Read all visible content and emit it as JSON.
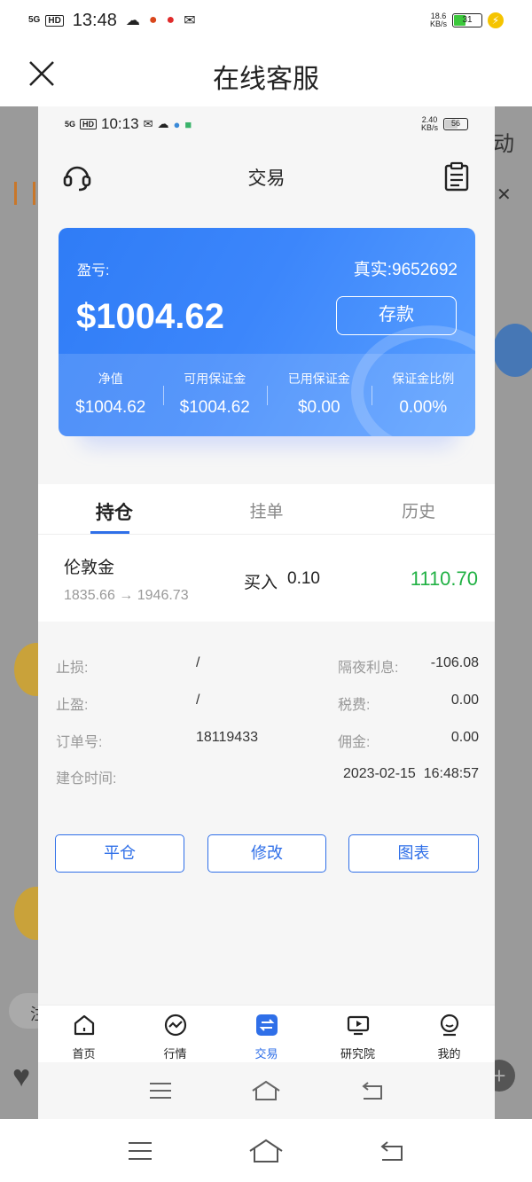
{
  "outer_status": {
    "network": "5G",
    "hd": "HD",
    "time": "13:48",
    "speed_value": "18.6",
    "speed_unit": "KB/s",
    "battery": "31"
  },
  "outer_header": {
    "title": "在线客服"
  },
  "backdrop": {
    "partial_text_right": "动",
    "partial_text_left": "注"
  },
  "inner_status": {
    "network": "5G",
    "hd": "HD",
    "time": "10:13",
    "speed_value": "2.40",
    "speed_unit": "KB/s",
    "battery": "56"
  },
  "header": {
    "title": "交易"
  },
  "account_card": {
    "pl_label": "盈亏:",
    "account": "真实:9652692",
    "amount": "$1004.62",
    "deposit_label": "存款",
    "stats": [
      {
        "label": "净值",
        "value": "$1004.62"
      },
      {
        "label": "可用保证金",
        "value": "$1004.62"
      },
      {
        "label": "已用保证金",
        "value": "$0.00"
      },
      {
        "label": "保证金比例",
        "value": "0.00%"
      }
    ]
  },
  "tabs": [
    {
      "label": "持仓",
      "active": true
    },
    {
      "label": "挂单",
      "active": false
    },
    {
      "label": "历史",
      "active": false
    }
  ],
  "position": {
    "symbol": "伦敦金",
    "open_price": "1835.66",
    "arrow": "→",
    "current_price": "1946.73",
    "side": "买入",
    "lots": "0.10",
    "profit": "1110.70"
  },
  "details": {
    "stop_loss_label": "止损:",
    "stop_loss_value": "/",
    "take_profit_label": "止盈:",
    "take_profit_value": "/",
    "order_no_label": "订单号:",
    "order_no_value": "18119433",
    "open_time_label": "建仓时间:",
    "open_time_value": "2023-02-15  16:48:57",
    "swap_label": "隔夜利息:",
    "swap_value": "-106.08",
    "tax_label": "税费:",
    "tax_value": "0.00",
    "commission_label": "佣金:",
    "commission_value": "0.00"
  },
  "actions": {
    "close_label": "平仓",
    "modify_label": "修改",
    "chart_label": "图表"
  },
  "tabbar": [
    {
      "label": "首页",
      "icon": "home-icon"
    },
    {
      "label": "行情",
      "icon": "chart-icon"
    },
    {
      "label": "交易",
      "icon": "swap-icon",
      "active": true
    },
    {
      "label": "研究院",
      "icon": "video-icon"
    },
    {
      "label": "我的",
      "icon": "user-icon"
    }
  ],
  "colors": {
    "accent": "#2f6fe8",
    "card_blue": "#3c86fb",
    "profit_green": "#21b144"
  }
}
